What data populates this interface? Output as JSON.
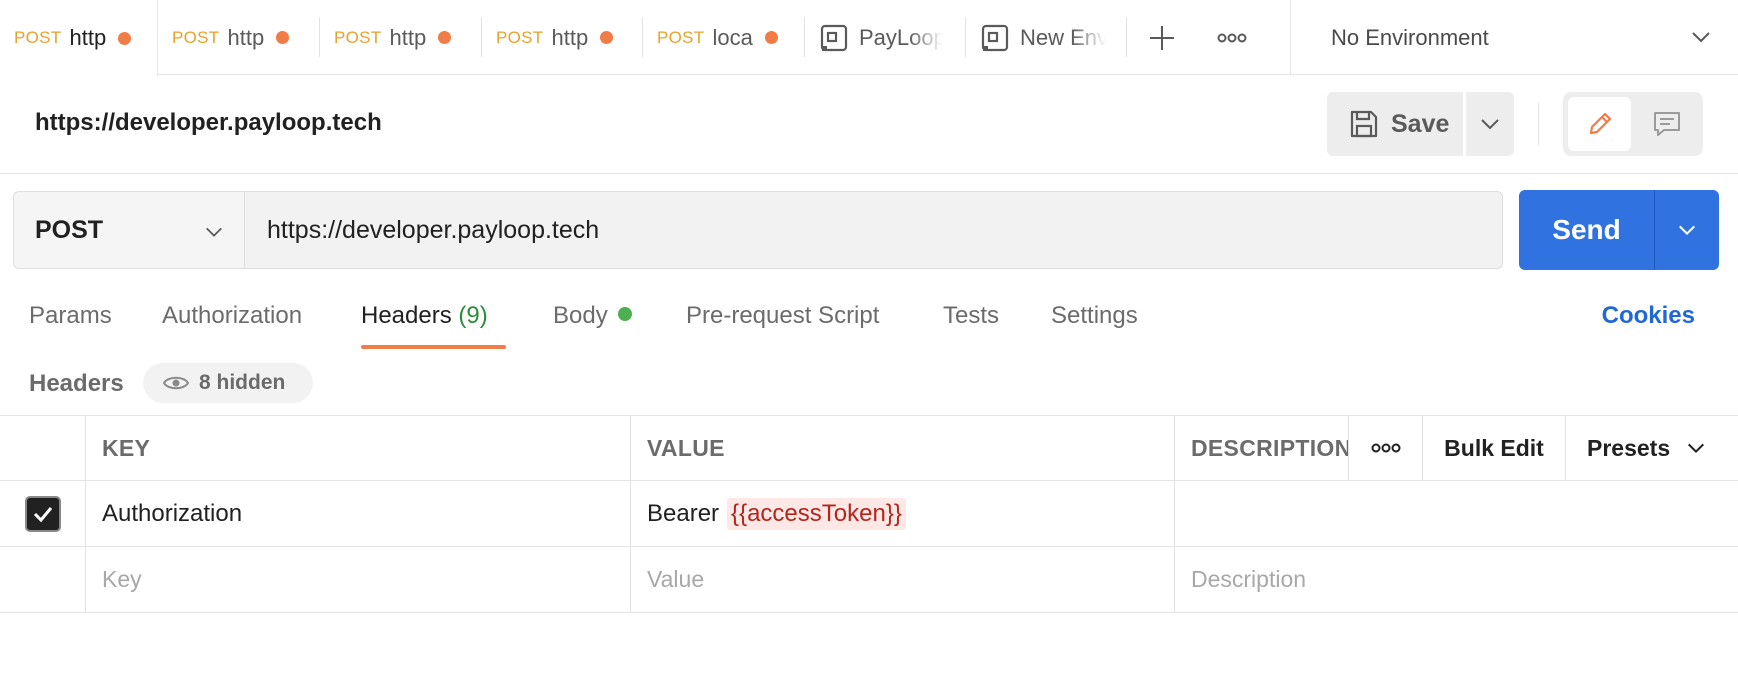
{
  "tabs": [
    {
      "method": "POST",
      "label": "http",
      "unsaved": true
    },
    {
      "method": "POST",
      "label": "http",
      "unsaved": true
    },
    {
      "method": "POST",
      "label": "http",
      "unsaved": true
    },
    {
      "method": "POST",
      "label": "http",
      "unsaved": true
    },
    {
      "method": "POST",
      "label": "loca",
      "unsaved": true
    },
    {
      "label": "PayLoop"
    },
    {
      "label": "New Env"
    }
  ],
  "environment": {
    "label": "No Environment"
  },
  "request": {
    "title": "https://developer.payloop.tech",
    "method": "POST",
    "url": "https://developer.payloop.tech"
  },
  "toolbar": {
    "save_label": "Save",
    "send_label": "Send"
  },
  "request_tabs": {
    "params": "Params",
    "authorization": "Authorization",
    "headers": "Headers",
    "headers_count": "(9)",
    "body": "Body",
    "prerequest": "Pre-request Script",
    "tests": "Tests",
    "settings": "Settings",
    "cookies": "Cookies"
  },
  "headers_bar": {
    "label": "Headers",
    "hidden_label": "8 hidden"
  },
  "table": {
    "columns": {
      "key": "KEY",
      "value": "VALUE",
      "description": "DESCRIPTION",
      "bulk_edit": "Bulk Edit",
      "presets": "Presets"
    },
    "rows": [
      {
        "checked": true,
        "key": "Authorization",
        "value_prefix": "Bearer",
        "value_variable": "{{accessToken}}",
        "description": ""
      }
    ],
    "placeholders": {
      "key": "Key",
      "value": "Value",
      "description": "Description"
    }
  },
  "colors": {
    "accent_orange": "#f07c47",
    "send_blue": "#2f72e0",
    "method_post": "#e8a228",
    "variable_red": "#b3261e",
    "status_green": "#4caf50"
  }
}
